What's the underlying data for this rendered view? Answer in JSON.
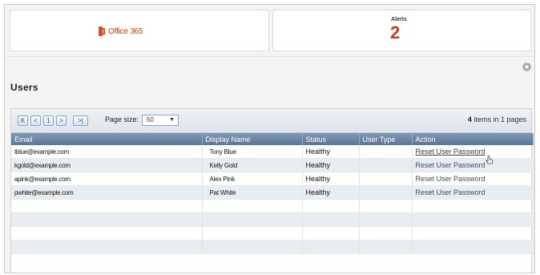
{
  "header": {
    "brand": "Office 365",
    "brand_color": "#d83b01",
    "alerts_label": "Alerts",
    "alerts_count": "2",
    "alerts_color": "#d33a1a"
  },
  "toolbar": {
    "settings_icon": "gear-icon"
  },
  "page": {
    "title": "Users"
  },
  "pager": {
    "first": "K",
    "prev": "<",
    "page": "1",
    "next": ">",
    "last": ">|",
    "page_size_label": "Page size:",
    "page_size_value": "50",
    "items_count": "4",
    "items_text": "items in 1 pages"
  },
  "columns": [
    "Email",
    "Display Name",
    "Status",
    "User Type",
    "Action"
  ],
  "rows": [
    {
      "email": "tblue@example.com",
      "display_name": "Tony Blue",
      "status": "Healthy",
      "user_type": "",
      "action": "Reset User Password"
    },
    {
      "email": "kgold@example.com",
      "display_name": "Kelly Gold",
      "status": "Healthy",
      "user_type": "",
      "action": "Reset User Password"
    },
    {
      "email": "apink@example.com",
      "display_name": "Alex Pink",
      "status": "Healthy",
      "user_type": "",
      "action": "Reset User Password"
    },
    {
      "email": "pwhite@example.com",
      "display_name": "Pat White",
      "status": "Healthy",
      "user_type": "",
      "action": "Reset User Password"
    }
  ]
}
